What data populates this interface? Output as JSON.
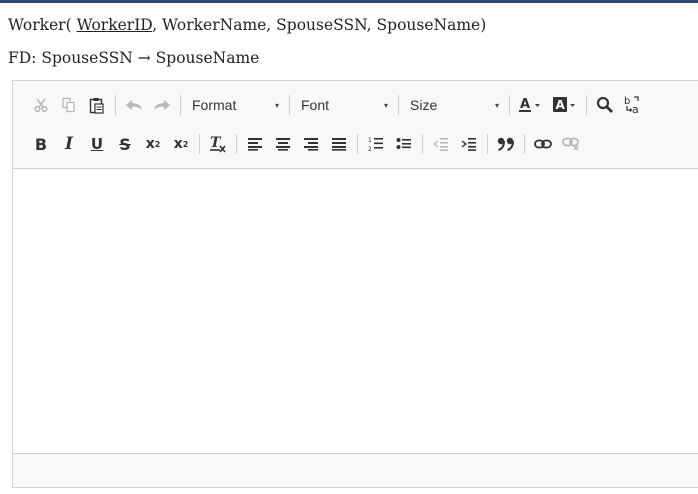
{
  "schema": {
    "relation": "Worker(",
    "key": "WorkerID",
    "rest": ", WorkerName, SpouseSSN, SpouseName)"
  },
  "fd": {
    "text": "FD: SpouseSSN → SpouseName"
  },
  "toolbar": {
    "format_label": "Format",
    "font_label": "Font",
    "size_label": "Size",
    "dropdown_arrow": "▾",
    "bold": "B",
    "italic": "I",
    "underline": "U",
    "strike": "S",
    "subscript": "x",
    "subscript_mark": "2",
    "superscript": "x",
    "superscript_mark": "2",
    "icons_row1": [
      "cut-icon",
      "copy-icon",
      "paste-icon",
      "undo-icon",
      "redo-icon",
      "text-color-icon",
      "background-color-icon",
      "find-icon",
      "replace-icon"
    ],
    "icons_row2": [
      "bold-icon",
      "italic-icon",
      "underline-icon",
      "strikethrough-icon",
      "subscript-icon",
      "superscript-icon",
      "remove-format-icon",
      "align-left-icon",
      "align-center-icon",
      "align-right-icon",
      "justify-icon",
      "numbered-list-icon",
      "bulleted-list-icon",
      "decrease-indent-icon",
      "increase-indent-icon",
      "blockquote-icon",
      "link-icon",
      "unlink-icon"
    ]
  },
  "colors": {
    "top_rule": "#2f4a6d",
    "toolbar_bg": "#f8f8f8",
    "border": "#d1d1d1",
    "disabled_icon": "#b8b8b8",
    "icon": "#333333"
  }
}
